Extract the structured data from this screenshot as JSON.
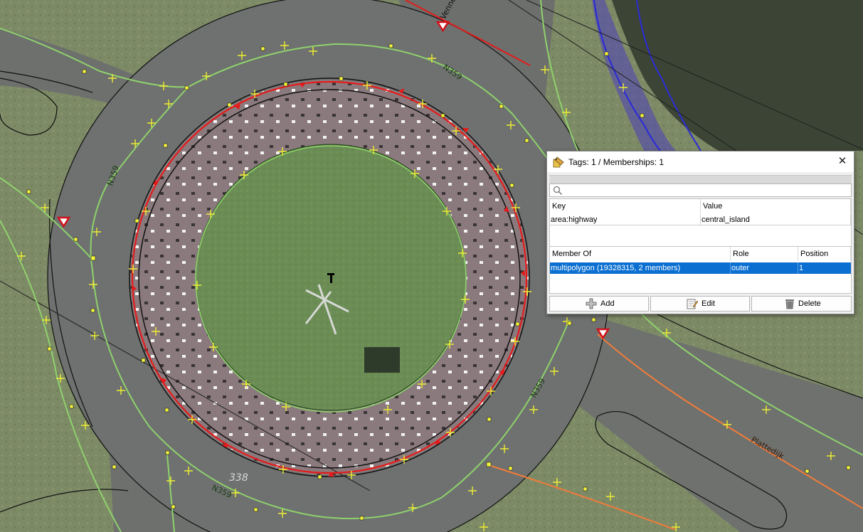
{
  "map": {
    "road_ref_labels": [
      "N359",
      "N359",
      "N359",
      "N359"
    ],
    "street_labels": [
      "Plattedijk",
      "Venne"
    ],
    "house_number": "338"
  },
  "dialog": {
    "title": "Tags: 1 / Memberships: 1",
    "close_symbol": "✕",
    "search_placeholder": "",
    "tags": {
      "columns": [
        "Key",
        "Value"
      ],
      "rows": [
        {
          "key": "area:highway",
          "value": "central_island"
        }
      ]
    },
    "memberships": {
      "columns": [
        "Member Of",
        "Role",
        "Position"
      ],
      "rows": [
        {
          "member_of": "multipolygon (19328315, 2 members)",
          "role": "outer",
          "position": "1"
        }
      ]
    },
    "buttons": {
      "add": "Add",
      "edit": "Edit",
      "delete": "Delete"
    },
    "icons": {
      "title": "tag-editor-icon",
      "search": "search-icon",
      "add": "plus-icon",
      "edit": "edit-icon",
      "delete": "trash-icon"
    }
  },
  "colors": {
    "selection": "#0a6fd1",
    "selected_way": "#e51b1b",
    "road_casing": "#8fd16d",
    "water_way": "#2a2ad8",
    "highlight_orange": "#f07c3a"
  }
}
